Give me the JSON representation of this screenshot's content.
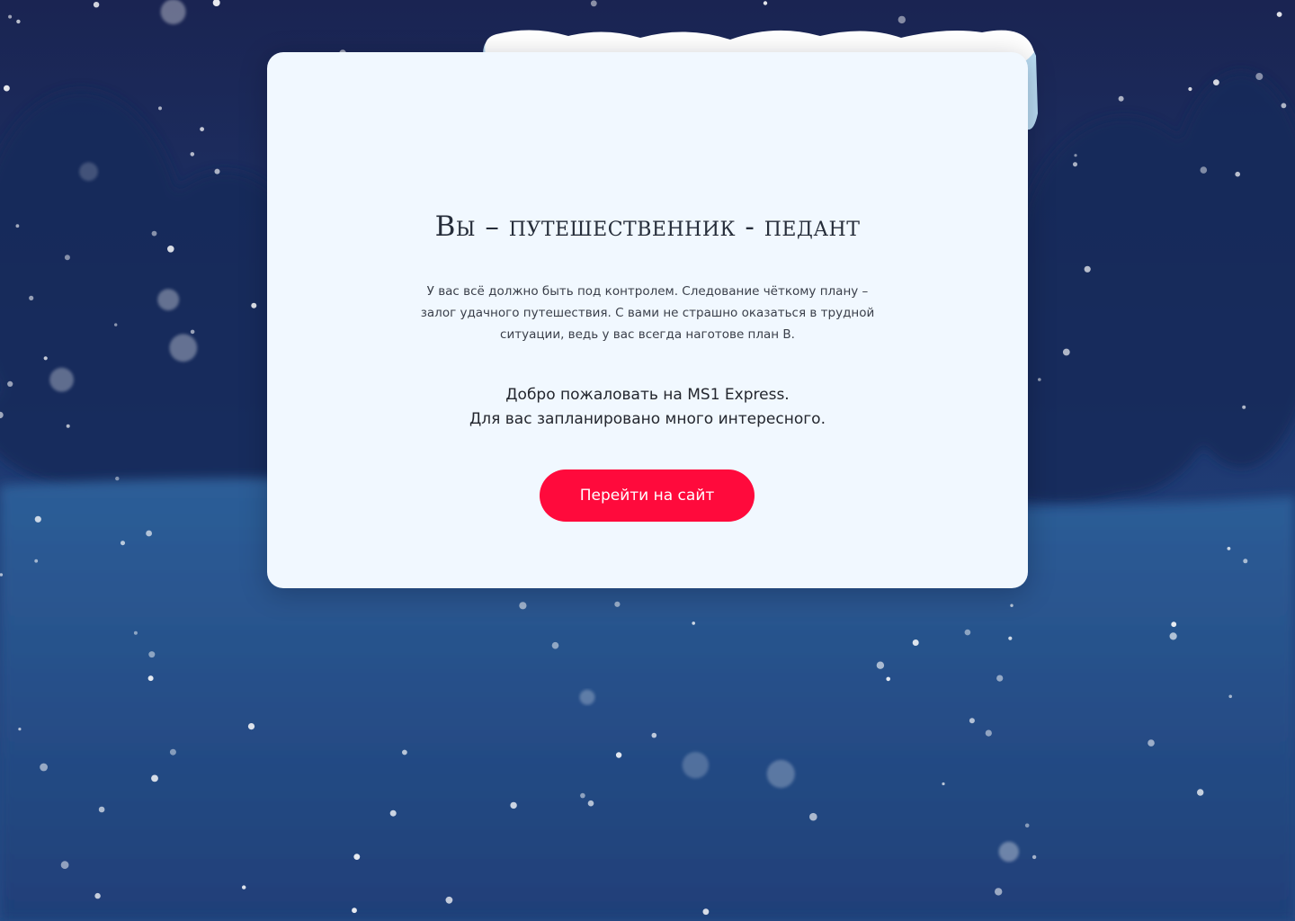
{
  "page": {
    "title": "Вы – путешественник - педант",
    "description": "У вас всё должно быть под контролем. Следование чёткому плану – залог удачного путешествия. С вами не страшно оказаться в трудной ситуации, ведь у вас всегда наготове план B.",
    "welcome_line1": "Добро пожаловать на MS1 Express.",
    "welcome_line2": "Для вас запланировано много интересного.",
    "cta_label": "Перейти на сайт"
  },
  "colors": {
    "background_night": "#1b2a5a",
    "background_snowfield": "#2c5b95",
    "card_background": "#f1f8ff",
    "cta_background": "#ff0a3c",
    "cta_text": "#ffffff",
    "title_text": "#262d3a"
  },
  "icons": {
    "snow_cap": "snow-cap-icon",
    "map": "world-map-icon",
    "airplane": "airplane-icon",
    "pin": "map-pin-icon"
  }
}
